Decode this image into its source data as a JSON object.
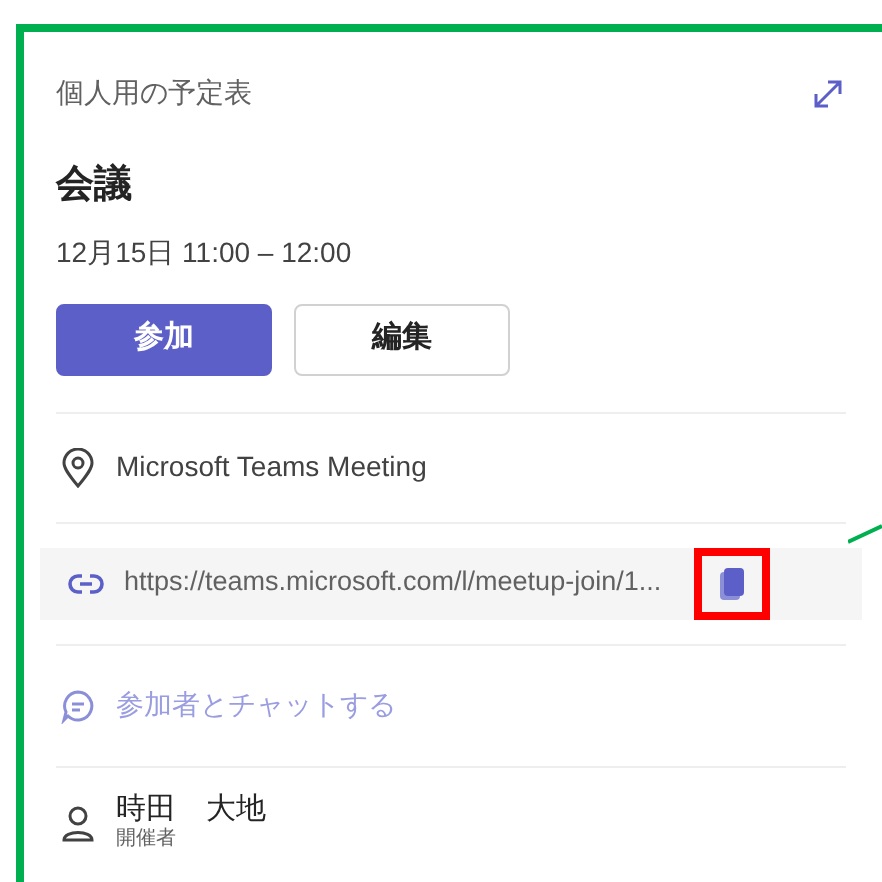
{
  "header": {
    "title": "個人用の予定表"
  },
  "event": {
    "title": "会議",
    "time": "12月15日 11:00 – 12:00"
  },
  "buttons": [
    {
      "label": "参加",
      "kind": "primary"
    },
    {
      "label": "編集",
      "kind": "secondary"
    }
  ],
  "location": "Microsoft Teams Meeting",
  "link": {
    "url": "https://teams.microsoft.com/l/meetup-join/1...",
    "copy_highlighted": true
  },
  "chat": "参加者とチャットする",
  "organizer": {
    "name": "時田　大地",
    "role": "開催者"
  }
}
